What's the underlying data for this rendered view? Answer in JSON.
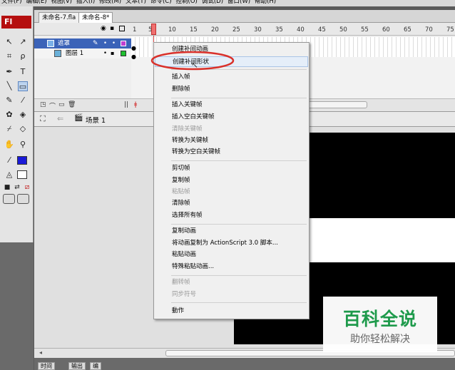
{
  "menubar": {
    "items": [
      "文件(F)",
      "编辑(E)",
      "视图(V)",
      "插入(I)",
      "修改(M)",
      "文本(T)",
      "命令(C)",
      "控制(O)",
      "调试(D)",
      "窗口(W)",
      "帮助(H)"
    ]
  },
  "app": {
    "logo": "Fl"
  },
  "doc_tabs": [
    {
      "label": "未命名-7.fla"
    },
    {
      "label": "未命名-8*"
    }
  ],
  "timeline": {
    "frame_numbers": [
      "1",
      "5",
      "10",
      "15",
      "20",
      "25",
      "30",
      "35",
      "40",
      "45",
      "50",
      "55",
      "60",
      "65",
      "70",
      "75"
    ],
    "layers": [
      {
        "name": "遮罩",
        "selected": true
      },
      {
        "name": "图层 1",
        "selected": false
      }
    ]
  },
  "edit_bar": {
    "scene": "场景 1"
  },
  "context_menu": {
    "items": [
      {
        "label": "创建补间动画",
        "disabled": false
      },
      {
        "label": "创建补间形状",
        "disabled": false,
        "highlighted": true
      },
      {
        "label": "插入帧",
        "disabled": false
      },
      {
        "label": "删除帧",
        "disabled": false
      },
      {
        "label": "插入关键帧",
        "disabled": false
      },
      {
        "label": "插入空白关键帧",
        "disabled": false
      },
      {
        "label": "清除关键帧",
        "disabled": true
      },
      {
        "label": "转换为关键帧",
        "disabled": false
      },
      {
        "label": "转换为空白关键帧",
        "disabled": false
      },
      {
        "label": "剪切帧",
        "disabled": false
      },
      {
        "label": "复制帧",
        "disabled": false
      },
      {
        "label": "粘贴帧",
        "disabled": true
      },
      {
        "label": "清除帧",
        "disabled": false
      },
      {
        "label": "选择所有帧",
        "disabled": false
      },
      {
        "label": "复制动画",
        "disabled": false
      },
      {
        "label": "将动画复制为 ActionScript 3.0 脚本...",
        "disabled": false
      },
      {
        "label": "粘贴动画",
        "disabled": false
      },
      {
        "label": "特殊粘贴动画...",
        "disabled": false
      },
      {
        "label": "翻转帧",
        "disabled": true
      },
      {
        "label": "同步符号",
        "disabled": true
      },
      {
        "label": "動作",
        "disabled": false
      }
    ]
  },
  "bottom_tabs": [
    "时间",
    "输出",
    "编"
  ],
  "watermark": {
    "title": "百科全说",
    "subtitle": "助你轻松解决"
  },
  "colors": {
    "accent": "#3b63b8",
    "logo": "#b50f0f",
    "annotation": "#d9302a",
    "watermark": "#1e9a4b"
  }
}
